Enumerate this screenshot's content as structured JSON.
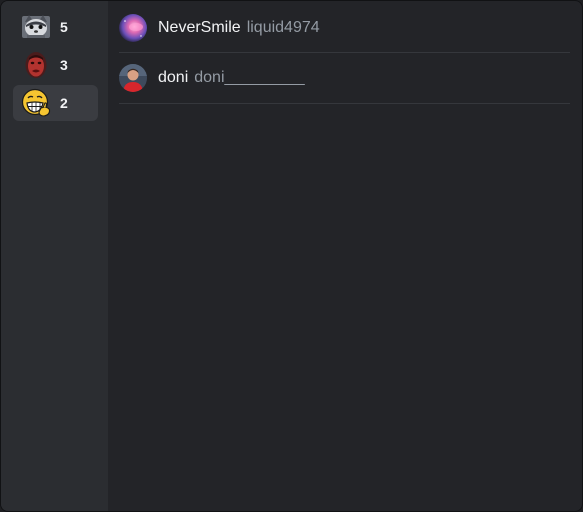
{
  "reactions": [
    {
      "emoji": "cat-face-emoji",
      "count": "5"
    },
    {
      "emoji": "red-face-emoji",
      "count": "3"
    },
    {
      "emoji": "grinning-thumbs-up-emoji",
      "count": "2"
    }
  ],
  "selected_reaction_index": 2,
  "reactors": [
    {
      "display_name": "NeverSmile",
      "username": "liquid4974",
      "avatar": "galaxy-avatar"
    },
    {
      "display_name": "doni",
      "username": "doni_________",
      "avatar": "person-avatar"
    }
  ],
  "colors": {
    "background": "#232428",
    "sidebar": "#2b2d31",
    "selected_tab": "#3a3c41",
    "text_primary": "#f2f3f5",
    "text_muted": "#949ba4"
  }
}
